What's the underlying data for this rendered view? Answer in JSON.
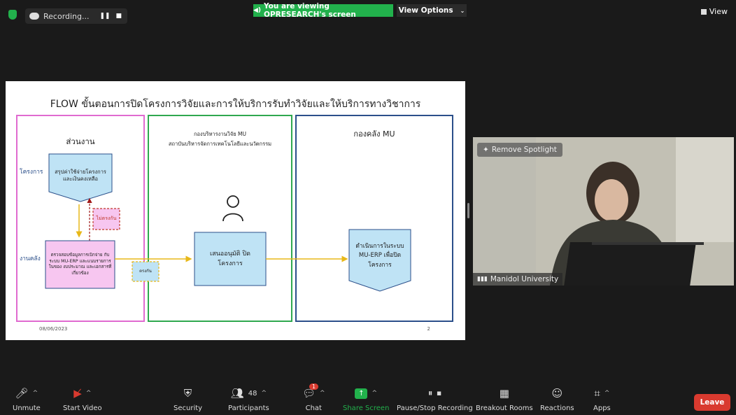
{
  "topbar": {
    "recording_label": "Recording...",
    "viewing_text": "You are viewing OPRESEARCH's screen",
    "view_options": "View Options",
    "view_label": "View"
  },
  "slide": {
    "title": "FLOW ขั้นตอนการปิดโครงการวิจัยและการให้บริการรับทำวิจัยและให้บริการทางวิชาการ",
    "lane1_title": "ส่วนงาน",
    "lane2_title_line1": "กองบริหารงานวิจัย MU",
    "lane2_title_line2": "สถาบันบริหารจัดการเทคโนโลยีและนวัตกรรม",
    "lane3_title": "กองคลัง MU",
    "label_project": "โครงการ",
    "label_finance": "งานคลัง",
    "box_summary": "สรุปค่าใช้จ่ายโครงการ และเงินคงเหลือ",
    "box_check": "ตรวจสอบข้อมูลการเบิกจ่าย กับระบบ MU-ERP และแนบรายการในของ งบประมาณ และเอกสารที่ เกี่ยวข้อง",
    "box_not_correct": "ไม่ตรงกัน",
    "box_correct": "ตรงกัน",
    "box_approve": "เสนออนุมัติ ปิดโครงการ",
    "box_erp": "ดำเนินการในระบบ MU-ERP เพื่อปิดโครงการ",
    "date": "08/06/2023",
    "page": "2"
  },
  "video": {
    "remove_spotlight": "Remove Spotlight",
    "participant_name": "Manidol University"
  },
  "toolbar": {
    "unmute": "Unmute",
    "start_video": "Start Video",
    "security": "Security",
    "participants": "Participants",
    "participant_count": "48",
    "chat": "Chat",
    "chat_badge": "1",
    "share_screen": "Share Screen",
    "pause_stop": "Pause/Stop Recording",
    "breakout": "Breakout Rooms",
    "reactions": "Reactions",
    "apps": "Apps",
    "leave": "Leave"
  },
  "colors": {
    "green": "#22b14c",
    "leave_red": "#d93a2f",
    "lane_pink": "#e06ad0",
    "lane_green": "#2fa84f",
    "lane_blue": "#2b4f8a",
    "box_blue": "#bfe3f5",
    "box_pink": "#f7c6f0"
  }
}
